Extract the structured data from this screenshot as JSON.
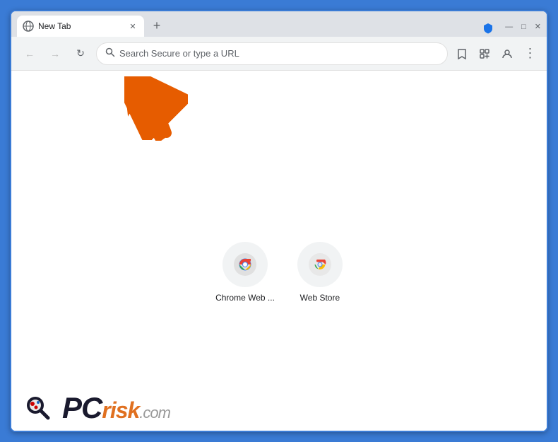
{
  "browser": {
    "tab": {
      "title": "New Tab",
      "favicon": "globe"
    },
    "new_tab_button": "+",
    "window_controls": {
      "minimize": "—",
      "maximize": "□",
      "close": "✕"
    },
    "shield_icon": "🛡",
    "address_bar": {
      "placeholder": "Search Secure or type a URL",
      "search_icon": "🔍"
    },
    "nav": {
      "back": "←",
      "forward": "→",
      "refresh": "↻"
    },
    "toolbar_icons": {
      "bookmark": "☆",
      "extensions": "🧩",
      "profile": "👤",
      "menu": "⋮"
    }
  },
  "shortcuts": [
    {
      "label": "Chrome Web ...",
      "type": "chrome"
    },
    {
      "label": "Web Store",
      "type": "chrome"
    }
  ],
  "watermark": {
    "pc_text": "PC",
    "risk_text": "risk",
    "dot_com": ".com"
  }
}
